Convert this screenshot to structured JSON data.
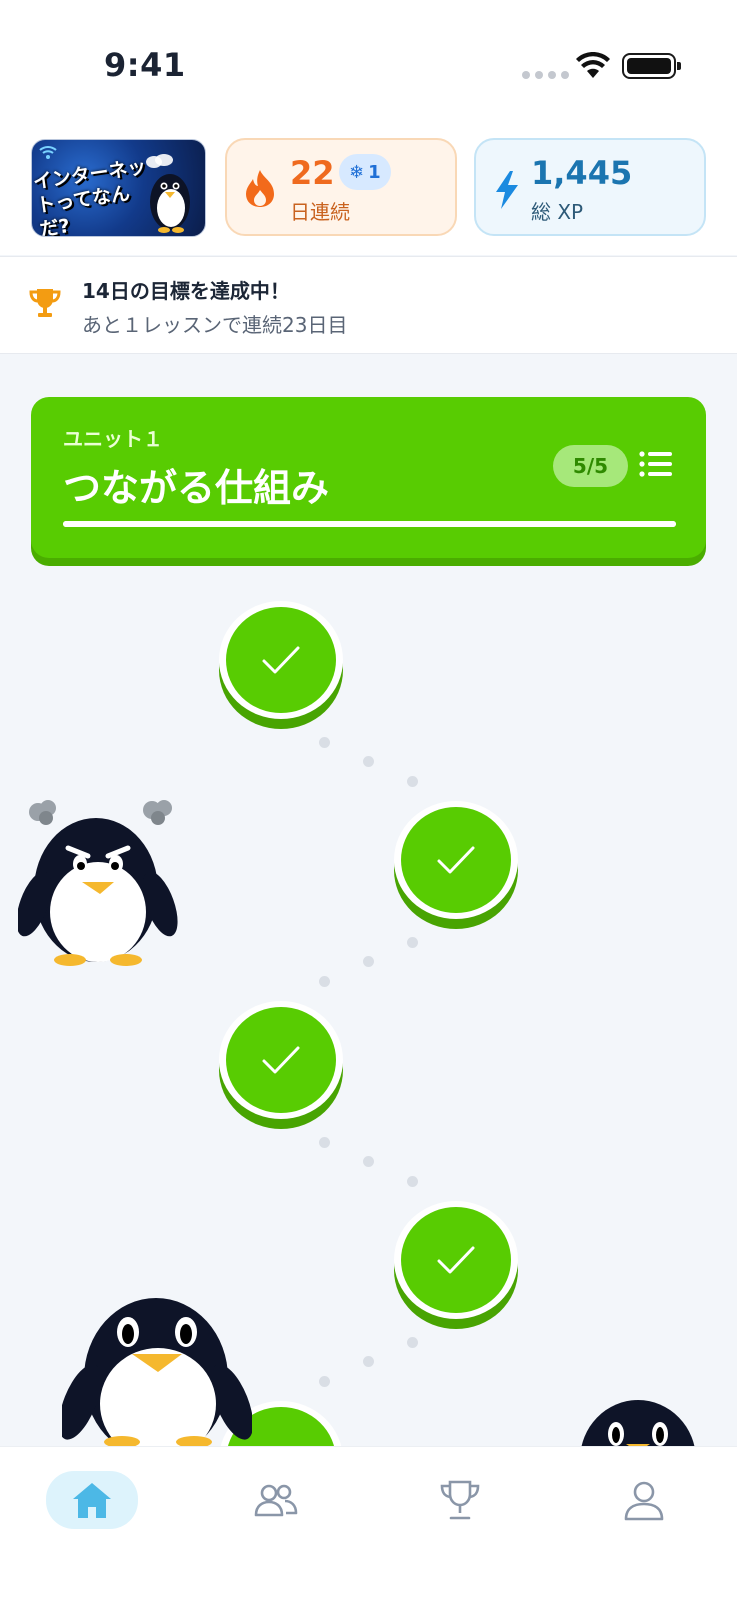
{
  "status_bar": {
    "time": "9:41"
  },
  "course": {
    "thumbnail_text": "インターネットってなんだ?"
  },
  "streak": {
    "days": "22",
    "label": "日連続",
    "freeze_count": "1"
  },
  "xp": {
    "total": "1,445",
    "label": "総 XP"
  },
  "goal": {
    "title": "14日の目標を達成中！",
    "subtitle": "あと１レッスンで連続23日目"
  },
  "unit": {
    "label": "ユニット１",
    "title": "つながる仕組み",
    "count": "5/5",
    "progress_fraction": 1.0
  },
  "path": {
    "nodes": [
      {
        "state": "completed",
        "icon": "check-icon"
      },
      {
        "state": "completed",
        "icon": "check-icon"
      },
      {
        "state": "completed",
        "icon": "check-icon"
      },
      {
        "state": "completed",
        "icon": "check-icon"
      },
      {
        "state": "completed",
        "icon": "check-icon"
      }
    ]
  },
  "bottom_nav": {
    "items": [
      {
        "name": "home",
        "icon": "home-icon",
        "active": true
      },
      {
        "name": "friends",
        "icon": "friends-icon",
        "active": false
      },
      {
        "name": "leaderboard",
        "icon": "trophy-icon",
        "active": false
      },
      {
        "name": "profile",
        "icon": "profile-icon",
        "active": false
      }
    ]
  },
  "colors": {
    "accent_green": "#58cc02",
    "streak_orange": "#ef6a1f",
    "xp_blue": "#1b75b0",
    "nav_active": "#4cb8e6"
  }
}
